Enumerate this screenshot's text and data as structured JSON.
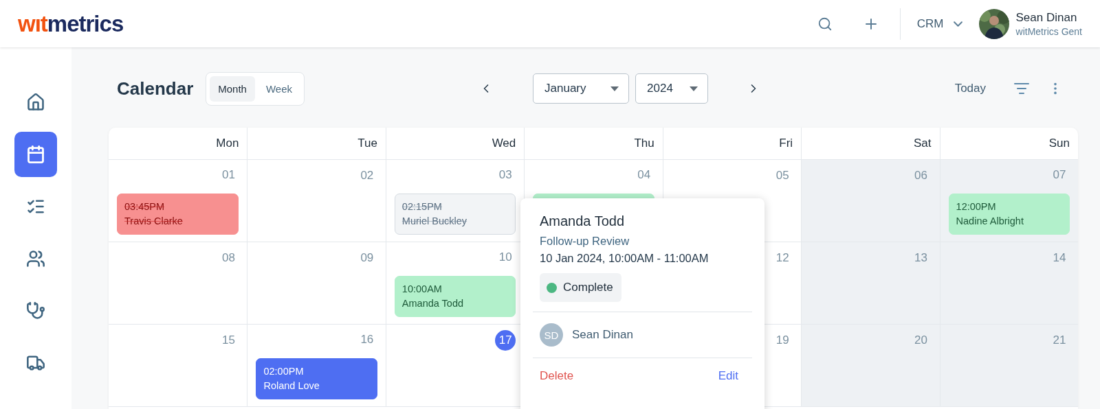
{
  "logo": {
    "accent": "wıt",
    "rest": "metrics"
  },
  "header": {
    "module": "CRM",
    "user": {
      "name": "Sean Dinan",
      "org": "witMetrics Gent"
    }
  },
  "sidebar": {
    "items": [
      {
        "selected": false
      },
      {
        "selected": true
      },
      {
        "selected": false
      },
      {
        "selected": false
      },
      {
        "selected": false
      },
      {
        "selected": false
      }
    ]
  },
  "toolbar": {
    "title": "Calendar",
    "views": [
      {
        "label": "Month",
        "selected": true
      },
      {
        "label": "Week",
        "selected": false
      }
    ],
    "month": "January",
    "year": "2024",
    "today": "Today"
  },
  "weekdays": [
    "Mon",
    "Tue",
    "Wed",
    "Thu",
    "Fri",
    "Sat",
    "Sun"
  ],
  "weeks": [
    [
      {
        "day": "01",
        "weekend": false,
        "events": [
          {
            "time": "03:45PM",
            "name": "Travis Clarke",
            "kind": "cancelled"
          }
        ]
      },
      {
        "day": "02",
        "weekend": false
      },
      {
        "day": "03",
        "weekend": false,
        "events": [
          {
            "time": "02:15PM",
            "name": "Muriel Buckley",
            "kind": "past"
          }
        ]
      },
      {
        "day": "04",
        "weekend": false,
        "events": [
          {
            "kind": "complete"
          }
        ]
      },
      {
        "day": "05",
        "weekend": false
      },
      {
        "day": "06",
        "weekend": true
      },
      {
        "day": "07",
        "weekend": true,
        "events": [
          {
            "time": "12:00PM",
            "name": "Nadine Albright",
            "kind": "complete"
          }
        ]
      }
    ],
    [
      {
        "day": "08",
        "weekend": false
      },
      {
        "day": "09",
        "weekend": false
      },
      {
        "day": "10",
        "weekend": false,
        "events": [
          {
            "time": "10:00AM",
            "name": "Amanda Todd",
            "kind": "complete"
          }
        ]
      },
      {
        "day": "12",
        "weekend": false
      },
      {
        "day": "13",
        "weekend": true
      },
      {
        "day": "14",
        "weekend": true
      }
    ],
    [
      {
        "day": "15",
        "weekend": false
      },
      {
        "day": "16",
        "weekend": false,
        "events": [
          {
            "time": "02:00PM",
            "name": "Roland Love",
            "kind": "scheduled"
          }
        ]
      },
      {
        "day": "17",
        "weekend": false,
        "today": true
      },
      {
        "day": "19",
        "weekend": false
      },
      {
        "day": "20",
        "weekend": true
      },
      {
        "day": "21",
        "weekend": true
      }
    ]
  ],
  "popover": {
    "name": "Amanda Todd",
    "type": "Follow-up Review",
    "datetime": "10 Jan 2024, 10:00AM - 11:00AM",
    "status": {
      "label": "Complete",
      "color": "#4cb782"
    },
    "attendee": {
      "initials": "SD",
      "name": "Sean Dinan"
    },
    "delete": "Delete",
    "edit": "Edit"
  }
}
